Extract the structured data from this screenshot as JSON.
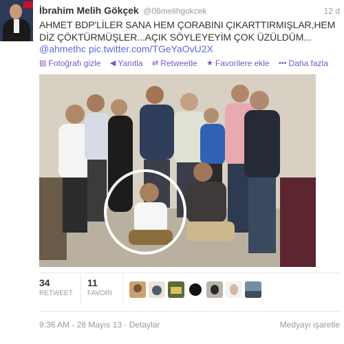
{
  "tweet": {
    "author_name": "İbrahim Melih Gökçek",
    "author_handle": "@06melihgokcek",
    "time_ago": "12 d",
    "text": "AHMET BDP'LİLER SANA HEM ÇORABINI ÇIKARTTIRMIŞLAR,HEM DİZ ÇÖKTÜRMÜŞLER...AÇIK SÖYLEYEYİM ÇOK ÜZÜLDÜM...",
    "mention": "@ahmethc",
    "link": "pic.twitter.com/TGeYaOvU2X"
  },
  "actions": {
    "hide_photo": "Fotoğrafı gizle",
    "reply": "Yanıtla",
    "retweet": "Retweetle",
    "favorite": "Favorilere ekle",
    "more": "Daha fazla"
  },
  "stats": {
    "retweets_count": "34",
    "retweets_label": "RETWEET",
    "favorites_count": "11",
    "favorites_label": "FAVORI"
  },
  "footer": {
    "timestamp": "9:36 AM - 28 Mayıs 13",
    "separator": "·",
    "details": "Detaylar",
    "flag_media": "Medyayı işaretle"
  },
  "colors": {
    "link": "#5a6cd8",
    "action": "#7a55c8",
    "muted": "#999999"
  },
  "icons": {
    "hide_photo": "photo-icon",
    "reply": "reply-arrow-icon",
    "retweet": "retweet-icon",
    "favorite": "star-icon",
    "more": "ellipsis-icon"
  }
}
